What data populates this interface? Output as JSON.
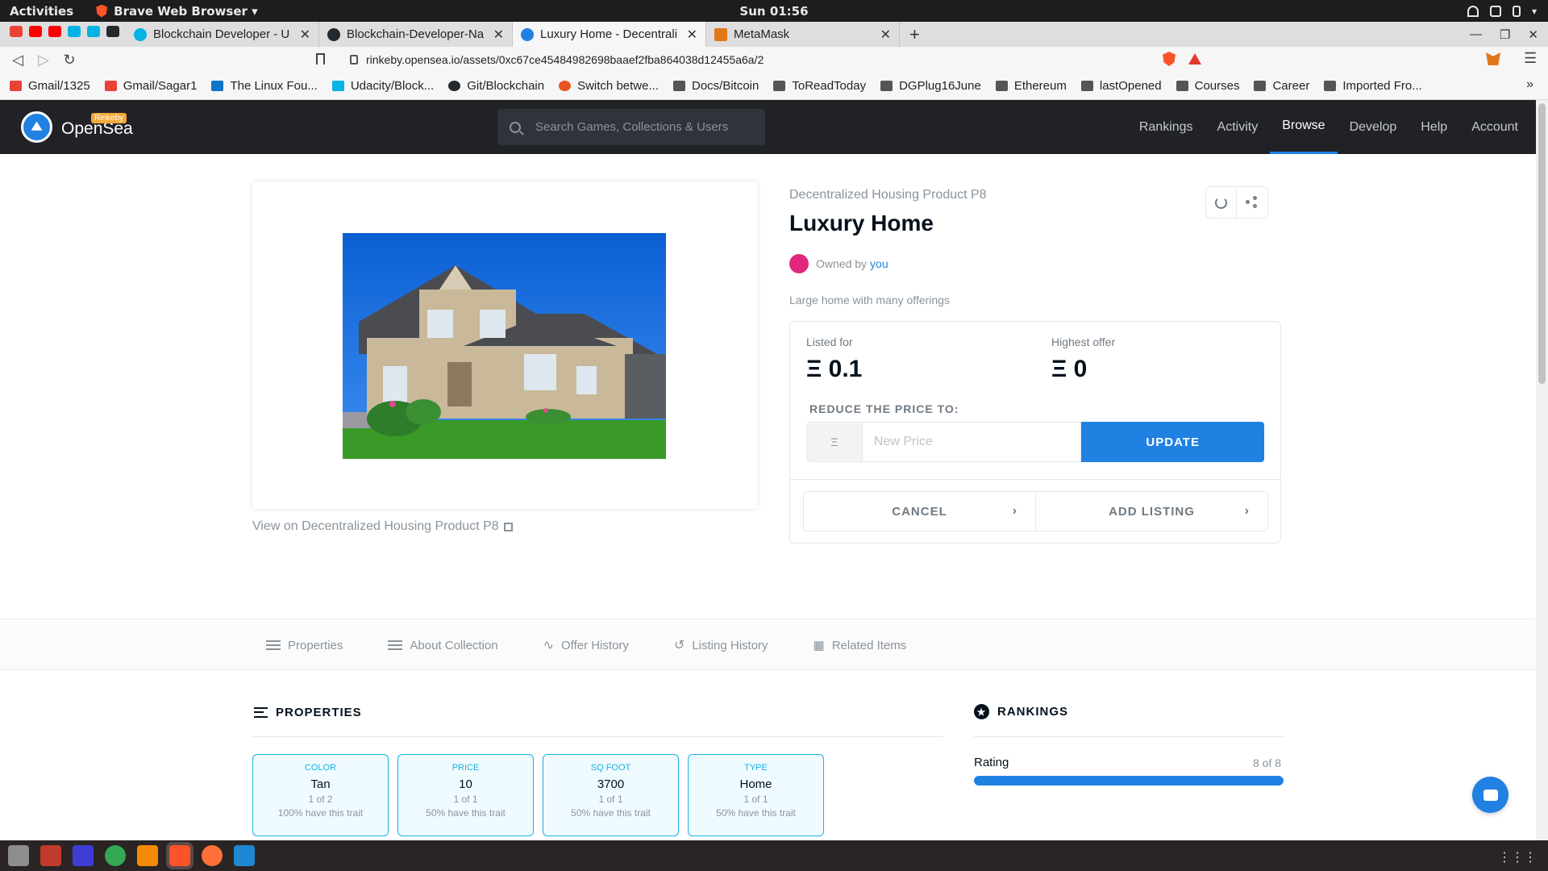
{
  "system": {
    "activities": "Activities",
    "app_name": "Brave Web Browser ▾",
    "clock": "Sun 01:56"
  },
  "browser": {
    "tabs": [
      {
        "title": "Blockchain Developer - Uda",
        "favicon_color": "#02b3e4"
      },
      {
        "title": "Blockchain-Developer-Nan",
        "favicon_color": "#24292e"
      },
      {
        "title": "Luxury Home - Decentraliz",
        "favicon_color": "#2081e2"
      },
      {
        "title": "MetaMask",
        "favicon_color": "#e2761b"
      }
    ],
    "url": "rinkeby.opensea.io/assets/0xc67ce45484982698baaef2fba864038d12455a6a/2",
    "bookmarks": [
      "Gmail/1325",
      "Gmail/Sagar1",
      "The Linux Fou...",
      "Udacity/Block...",
      "Git/Blockchain",
      "Switch betwe...",
      "Docs/Bitcoin",
      "ToReadToday",
      "DGPlug16June",
      "Ethereum",
      "lastOpened",
      "Courses",
      "Career",
      "Imported Fro..."
    ],
    "bookmarks_more": "»"
  },
  "header": {
    "brand": "OpenSea",
    "badge": "Rinkeby",
    "search_placeholder": "Search Games, Collections & Users",
    "nav": [
      "Rankings",
      "Activity",
      "Browse",
      "Develop",
      "Help",
      "Account"
    ],
    "active_nav": "Browse"
  },
  "asset": {
    "collection": "Decentralized Housing Product P8",
    "title": "Luxury Home",
    "owned_by": "Owned by",
    "owner": "you",
    "description": "Large home with many offerings",
    "view_link": "View on Decentralized Housing Product P8"
  },
  "listing": {
    "listed_label": "Listed for",
    "listed_value": "Ξ 0.1",
    "offer_label": "Highest offer",
    "offer_value": "Ξ 0",
    "reduce_label": "REDUCE THE PRICE TO:",
    "currency_symbol": "Ξ",
    "price_placeholder": "New Price",
    "update_label": "UPDATE",
    "cancel_label": "CANCEL",
    "add_listing_label": "ADD LISTING"
  },
  "tabs_strip": [
    "Properties",
    "About Collection",
    "Offer History",
    "Listing History",
    "Related Items"
  ],
  "properties": {
    "heading": "PROPERTIES",
    "items": [
      {
        "type": "COLOR",
        "value": "Tan",
        "count": "1 of 2",
        "pct": "100% have this trait"
      },
      {
        "type": "PRICE",
        "value": "10",
        "count": "1 of 1",
        "pct": "50% have this trait"
      },
      {
        "type": "SQ FOOT",
        "value": "3700",
        "count": "1 of 1",
        "pct": "50% have this trait"
      },
      {
        "type": "TYPE",
        "value": "Home",
        "count": "1 of 1",
        "pct": "50% have this trait"
      }
    ]
  },
  "rankings": {
    "heading": "RANKINGS",
    "label": "Rating",
    "count": "8 of 8",
    "fill_fraction": 1.0
  },
  "colors": {
    "accent": "#2081e2",
    "header_bg": "#202225",
    "trait_border": "#15b2e5",
    "avatar": "#e0267d"
  }
}
